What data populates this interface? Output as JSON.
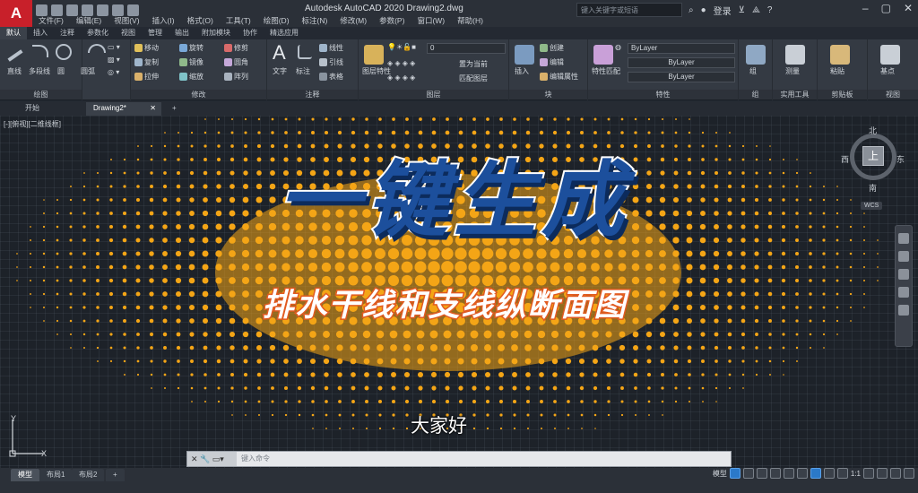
{
  "titlebar": {
    "app_letter": "A",
    "title": "Autodesk AutoCAD 2020    Drawing2.dwg",
    "search_placeholder": "键入关键字或短语",
    "login": "登录"
  },
  "menubar": [
    "文件(F)",
    "编辑(E)",
    "视图(V)",
    "插入(I)",
    "格式(O)",
    "工具(T)",
    "绘图(D)",
    "标注(N)",
    "修改(M)",
    "参数(P)",
    "窗口(W)",
    "帮助(H)"
  ],
  "ribbon_tabs": [
    "默认",
    "插入",
    "注释",
    "参数化",
    "视图",
    "管理",
    "输出",
    "附加模块",
    "协作",
    "精选应用"
  ],
  "ribbon": {
    "draw": {
      "label": "绘图",
      "items": [
        "直线",
        "多段线",
        "圆",
        "圆弧"
      ]
    },
    "modify": {
      "label": "修改",
      "items": [
        "移动",
        "旋转",
        "修剪",
        "复制",
        "镜像",
        "圆角",
        "拉伸",
        "缩放",
        "阵列"
      ]
    },
    "annotation": {
      "label": "注释",
      "items": [
        "文字",
        "标注",
        "线性",
        "引线",
        "表格"
      ]
    },
    "layers": {
      "label": "图层",
      "items": [
        "图层特性",
        "置为当前",
        "匹配图层"
      ],
      "current_layer": "0"
    },
    "block": {
      "label": "块",
      "items": [
        "插入",
        "创建",
        "编辑",
        "编辑属性"
      ]
    },
    "properties": {
      "label": "特性",
      "items": [
        "特性匹配"
      ],
      "bylayer_color": "ByLayer",
      "bylayer_line": "ByLayer",
      "bylayer_weight": "ByLayer"
    },
    "groups": {
      "label": "组",
      "items": [
        "组"
      ]
    },
    "utilities": {
      "label": "实用工具",
      "items": [
        "测量"
      ]
    },
    "clipboard": {
      "label": "剪贴板",
      "items": [
        "粘贴"
      ]
    },
    "view": {
      "label": "视图",
      "items": [
        "基点"
      ]
    }
  },
  "file_tabs": {
    "start": "开始",
    "drawing": "Drawing2*",
    "add": "+"
  },
  "viewport": {
    "label": "[-][俯视][二维线框]",
    "banner_main": "一键生成",
    "banner_sub": "排水干线和支线纵断面图",
    "caption": "大家好",
    "compass": {
      "north": "北",
      "south": "南",
      "east": "东",
      "west": "西",
      "top": "上"
    },
    "wcs": "WCS",
    "ucs_x": "X",
    "ucs_y": "Y"
  },
  "command": {
    "placeholder": "键入命令"
  },
  "layout_tabs": [
    "模型",
    "布局1",
    "布局2",
    "+"
  ],
  "status": {
    "model": "模型",
    "scale": "1:1"
  },
  "colors": {
    "accent": "#c8202a",
    "banner_blue": "#1c4f9c",
    "banner_orange": "#f4a516",
    "sub_stroke": "#e15a20"
  }
}
